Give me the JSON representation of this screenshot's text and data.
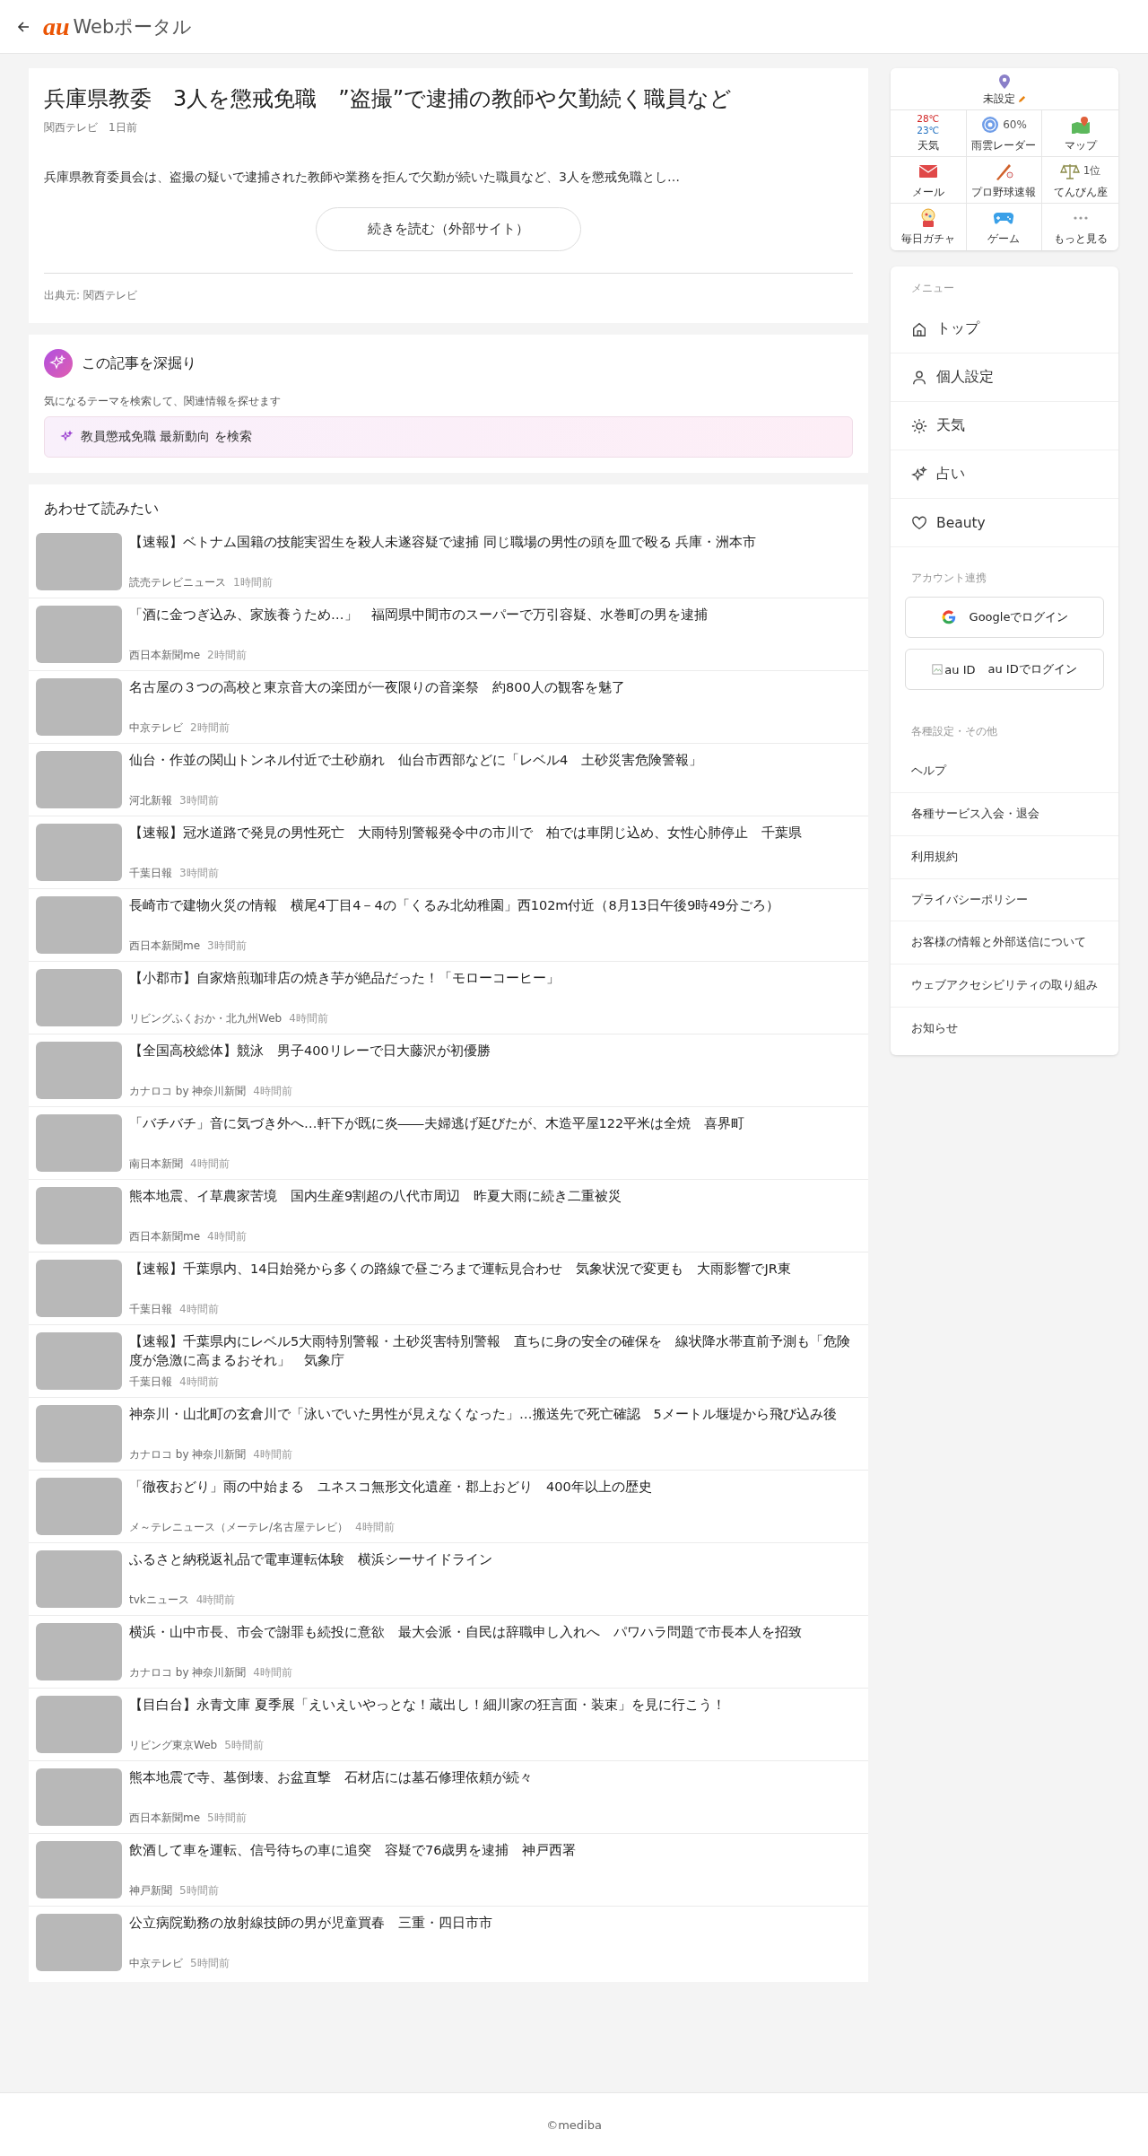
{
  "header": {
    "logo_mark": "au",
    "logo_text": "Webポータル"
  },
  "article": {
    "title": "兵庫県教委　3人を懲戒免職　”盗撮”で逮捕の教師や欠勤続く職員など",
    "source": "関西テレビ",
    "time": "1日前",
    "summary": "兵庫県教育委員会は、盗撮の疑いで逮捕された教師や業務を拒んで欠勤が続いた職員など、3人を懲戒免職とし…",
    "read_more": "続きを読む（外部サイト）",
    "credit": "出典元: 関西テレビ"
  },
  "deep_dive": {
    "title": "この記事を深掘り",
    "description": "気になるテーマを検索して、関連情報を探せます",
    "search_chip": "教員懲戒免職 最新動向 を検索"
  },
  "related": {
    "title": "あわせて読みたい",
    "items": [
      {
        "title": "【速報】ベトナム国籍の技能実習生を殺人未遂容疑で逮捕 同じ職場の男性の頭を皿で殴る 兵庫・洲本市",
        "source": "読売テレビニュース",
        "time": "1時間前"
      },
      {
        "title": "「酒に金つぎ込み、家族養うため…」　福岡県中間市のスーパーで万引容疑、水巻町の男を逮捕",
        "source": "西日本新聞me",
        "time": "2時間前"
      },
      {
        "title": "名古屋の３つの高校と東京音大の楽団が一夜限りの音楽祭　約800人の観客を魅了",
        "source": "中京テレビ",
        "time": "2時間前"
      },
      {
        "title": "仙台・作並の関山トンネル付近で土砂崩れ　仙台市西部などに「レベル4　土砂災害危険警報」",
        "source": "河北新報",
        "time": "3時間前"
      },
      {
        "title": "【速報】冠水道路で発見の男性死亡　大雨特別警報発令中の市川で　柏では車閉じ込め、女性心肺停止　千葉県",
        "source": "千葉日報",
        "time": "3時間前"
      },
      {
        "title": "長崎市で建物火災の情報　横尾4丁目4－4の「くるみ北幼稚園」西102m付近（8月13日午後9時49分ごろ）",
        "source": "西日本新聞me",
        "time": "3時間前"
      },
      {
        "title": "【小郡市】自家焙煎珈琲店の焼き芋が絶品だった！「モローコーヒー」",
        "source": "リビングふくおか・北九州Web",
        "time": "4時間前"
      },
      {
        "title": "【全国高校総体】競泳　男子400リレーで日大藤沢が初優勝",
        "source": "カナロコ by 神奈川新聞",
        "time": "4時間前"
      },
      {
        "title": "「バチバチ」音に気づき外へ…軒下が既に炎――夫婦逃げ延びたが、木造平屋122平米は全焼　喜界町",
        "source": "南日本新聞",
        "time": "4時間前"
      },
      {
        "title": "熊本地震、イ草農家苦境　国内生産9割超の八代市周辺　昨夏大雨に続き二重被災",
        "source": "西日本新聞me",
        "time": "4時間前"
      },
      {
        "title": "【速報】千葉県内、14日始発から多くの路線で昼ごろまで運転見合わせ　気象状況で変更も　大雨影響でJR東",
        "source": "千葉日報",
        "time": "4時間前"
      },
      {
        "title": "【速報】千葉県内にレベル5大雨特別警報・土砂災害特別警報　直ちに身の安全の確保を　線状降水帯直前予測も「危険度が急激に高まるおそれ」　気象庁",
        "source": "千葉日報",
        "time": "4時間前"
      },
      {
        "title": "神奈川・山北町の玄倉川で「泳いでいた男性が見えなくなった」…搬送先で死亡確認　5メートル堰堤から飛び込み後",
        "source": "カナロコ by 神奈川新聞",
        "time": "4時間前"
      },
      {
        "title": "「徹夜おどり」雨の中始まる　ユネスコ無形文化遺産・郡上おどり　400年以上の歴史",
        "source": "メ～テレニュース（メーテレ/名古屋テレビ）",
        "time": "4時間前"
      },
      {
        "title": "ふるさと納税返礼品で電車運転体験　横浜シーサイドライン",
        "source": "tvkニュース",
        "time": "4時間前"
      },
      {
        "title": "横浜・山中市長、市会で謝罪も続投に意欲　最大会派・自民は辞職申し入れへ　パワハラ問題で市長本人を招致",
        "source": "カナロコ by 神奈川新聞",
        "time": "4時間前"
      },
      {
        "title": "【目白台】永青文庫 夏季展「えいえいやっとな！蔵出し！細川家の狂言面・装束」を見に行こう！",
        "source": "リビング東京Web",
        "time": "5時間前"
      },
      {
        "title": "熊本地震で寺、墓倒壊、お盆直撃　石材店には墓石修理依頼が続々",
        "source": "西日本新聞me",
        "time": "5時間前"
      },
      {
        "title": "飲酒して車を運転、信号待ちの車に追突　容疑で76歳男を逮捕　神戸西署",
        "source": "神戸新聞",
        "time": "5時間前"
      },
      {
        "title": "公立病院勤務の放射線技師の男が児童買春　三重・四日市市",
        "source": "中京テレビ",
        "time": "5時間前"
      }
    ]
  },
  "quick_tiles": {
    "location": "未設定",
    "tiles": [
      {
        "kind": "weather",
        "label": "天気",
        "high": "28℃",
        "low": "23℃"
      },
      {
        "kind": "radar",
        "label": "雨雲レーダー",
        "value": "60%"
      },
      {
        "kind": "map",
        "label": "マップ"
      },
      {
        "kind": "mail",
        "label": "メール"
      },
      {
        "kind": "baseball",
        "label": "プロ野球速報"
      },
      {
        "kind": "horoscope",
        "label": "てんびん座",
        "value": "1位"
      },
      {
        "kind": "gacha",
        "label": "毎日ガチャ"
      },
      {
        "kind": "game",
        "label": "ゲーム"
      },
      {
        "kind": "more",
        "label": "もっと見る"
      }
    ]
  },
  "menu": {
    "heading": "メニュー",
    "items": [
      {
        "kind": "home",
        "label": "トップ"
      },
      {
        "kind": "person",
        "label": "個人設定"
      },
      {
        "kind": "sun",
        "label": "天気"
      },
      {
        "kind": "sparkle",
        "label": "占い"
      },
      {
        "kind": "heart",
        "label": "Beauty"
      }
    ]
  },
  "account": {
    "heading": "アカウント連携",
    "buttons": [
      {
        "kind": "google",
        "label": "Googleでログイン"
      },
      {
        "kind": "auid",
        "image_alt": "au ID",
        "label": "au IDでログイン"
      }
    ]
  },
  "settings": {
    "heading": "各種設定・その他",
    "links": [
      "ヘルプ",
      "各種サービス入会・退会",
      "利用規約",
      "プライバシーポリシー",
      "お客様の情報と外部送信について",
      "ウェブアクセシビリティの取り組み",
      "お知らせ"
    ]
  },
  "footer": {
    "copyright": "©mediba"
  }
}
